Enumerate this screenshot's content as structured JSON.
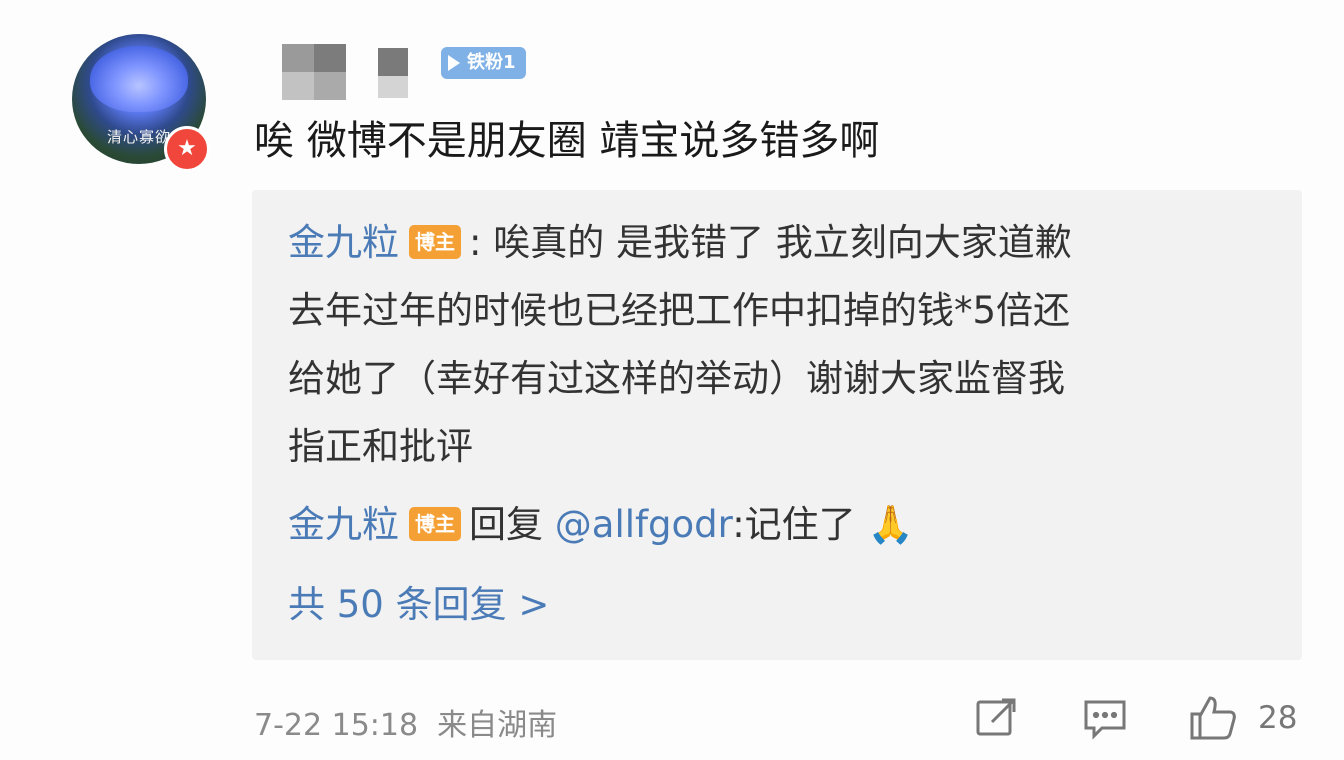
{
  "comment": {
    "avatar_text": "清心寡欲",
    "fan_tag": "铁粉1",
    "text": "唉 微博不是朋友圈 靖宝说多错多啊"
  },
  "replies": {
    "first": {
      "author": "金九粒",
      "tag": "博主",
      "line1": ": 唉真的 是我错了 我立刻向大家道歉",
      "line2": "去年过年的时候也已经把工作中扣掉的钱*5倍还",
      "line3": "给她了（幸好有过这样的举动）谢谢大家监督我",
      "line4": "指正和批评"
    },
    "second": {
      "author": "金九粒",
      "tag": "博主",
      "reply_word": "回复",
      "mention": "@allfgodr",
      "text": ":记住了",
      "emoji": "🙏"
    },
    "more": "共 50 条回复 >"
  },
  "footer": {
    "time": "7-22 15:18",
    "source": "来自湖南",
    "like_count": "28"
  },
  "icons": [
    "repost-icon",
    "comment-icon",
    "like-icon",
    "vip-star-icon"
  ],
  "colors": {
    "link": "#4a7bb7",
    "blogger_tag": "#f5a035",
    "fan_tag": "#7fb1e6",
    "vip": "#f0463b"
  }
}
